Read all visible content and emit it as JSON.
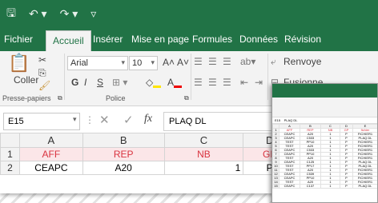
{
  "ribbon_tabs": [
    "Fichier",
    "Accueil",
    "Insérer",
    "Mise en page",
    "Formules",
    "Données",
    "Révision"
  ],
  "font": {
    "name": "Arial",
    "size": "10"
  },
  "labels": {
    "paste": "Coller",
    "clipboard": "Presse-papiers",
    "police": "Police",
    "wrap": "Renvoye",
    "merge": "Fusionne"
  },
  "cell_ref": "E15",
  "formula_value": "PLAQ DL",
  "columns": [
    "A",
    "B",
    "C",
    "D",
    "E"
  ],
  "rows": [
    {
      "n": "1",
      "cells": [
        "AFF",
        "REP",
        "NB",
        "GP",
        "fichier"
      ]
    },
    {
      "n": "2",
      "cells": [
        "CEAPC",
        "A20",
        "1",
        "P",
        "FICHIER1"
      ]
    }
  ],
  "mini": {
    "ref": "E15",
    "formula": "PLAQ DL",
    "columns": [
      "A",
      "B",
      "C",
      "D",
      "E"
    ],
    "rows": [
      [
        "AFF",
        "REP",
        "NB",
        "GP",
        "fichier"
      ],
      [
        "CEAPC",
        "A20",
        "1",
        "P",
        "FICHIER1"
      ],
      [
        "CEAPC",
        "C533",
        "1",
        "P",
        "PLAQ DL"
      ],
      [
        "TEST",
        "PP10",
        "1",
        "P",
        "FICHIER1"
      ],
      [
        "TEST",
        "A20",
        "1",
        "P",
        "FICHIER1"
      ],
      [
        "CEAPC",
        "C533",
        "1",
        "P",
        "FICHIER1"
      ],
      [
        "CEAPC",
        "PP10",
        "1",
        "P",
        "FICHIER1"
      ],
      [
        "TEST",
        "A20",
        "1",
        "P",
        "FICHIER1"
      ],
      [
        "CEAPC",
        "C125",
        "1",
        "P",
        "PLAQ DL"
      ],
      [
        "TEST",
        "PP17",
        "1",
        "P",
        "PLAQ DL"
      ],
      [
        "TEST",
        "A20",
        "1",
        "P",
        "FICHIER1"
      ],
      [
        "CEAPC",
        "C539",
        "1",
        "P",
        "FICHIER1"
      ],
      [
        "CEAPC",
        "PP10",
        "1",
        "P",
        "FICHIER1"
      ],
      [
        "TEST",
        "A20",
        "1",
        "P",
        "FICHIER1"
      ],
      [
        "CEAPC",
        "C137",
        "1",
        "P",
        "PLAQ DL"
      ]
    ]
  }
}
